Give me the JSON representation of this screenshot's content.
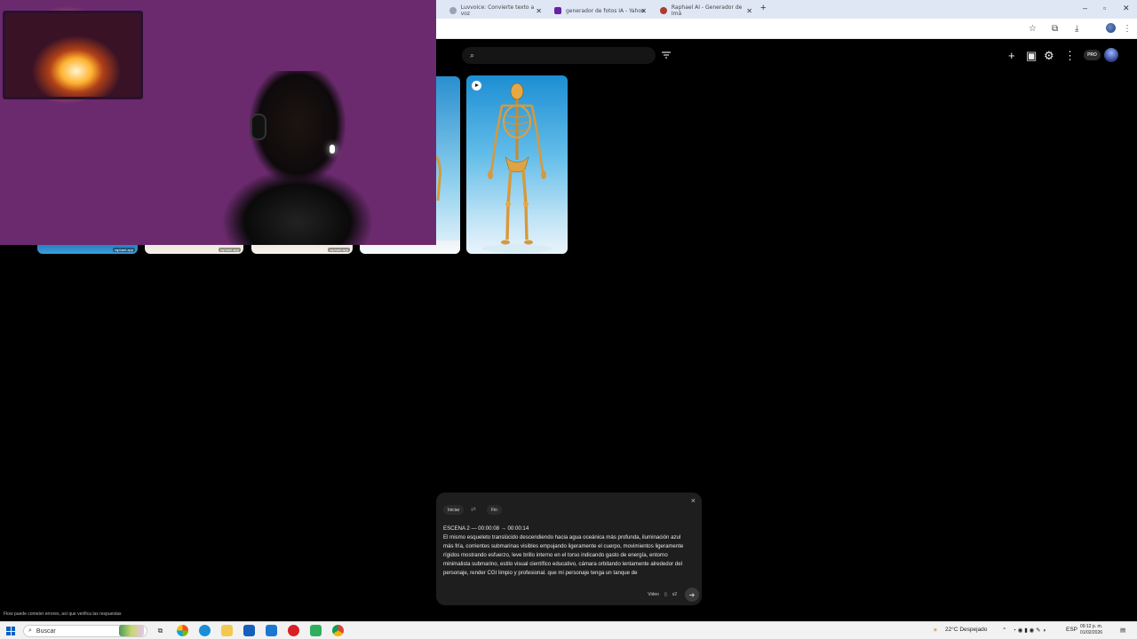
{
  "browser": {
    "tabs": [
      {
        "title": "Luvvoice: Convierte texto a voz",
        "fav_color": "#9aa3b5"
      },
      {
        "title": "generador de fotos IA - Yahoo",
        "fav_color": "#6a1fa8"
      },
      {
        "title": "Raphael AI - Generador de Imá",
        "fav_color": "#b03a2e"
      }
    ],
    "new_tab": "+",
    "window_controls": {
      "minimize": "–",
      "maximize": "▫",
      "close": "✕"
    }
  },
  "app": {
    "search": {
      "placeholder": "",
      "icon": "search-icon"
    },
    "header_icons": [
      "plus-icon",
      "film-icon",
      "gear-icon",
      "more-icon"
    ],
    "pro_badge": "PRO"
  },
  "gallery": {
    "watermark": "raphael.app"
  },
  "prompt_panel": {
    "start_chip": "Iniciar",
    "end_chip": "Fin",
    "close": "×",
    "scene_heading": "ESCENA 2 — 00:00:08 → 00:00:14",
    "prompt_text": "El mismo esqueleto translúcido descendiendo hacia agua oceánica más profunda, iluminación azul más fría, corrientes submarinas visibles empujando ligeramente el cuerpo, movimientos ligeramente rígidos mostrando esfuerzo, leve brillo interno en el torso indicando gasto de energía, entorno minimalista submarino, estilo visual científico educativo, cámara orbitando lentamente alrededor del personaje, render CGI limpio y profesional. que mi personaje tenga un tanque de",
    "mode_label": "Video",
    "count_label": "x2",
    "send_icon": "arrow-right-icon"
  },
  "disclaimer": "Flow puede cometer errores, así que verifica las respuestas",
  "taskbar": {
    "search_label": "Buscar",
    "weather": "22°C  Despejado",
    "language": "ESP",
    "time": "09:12 p. m.",
    "date": "01/02/2026"
  },
  "colors": {
    "accent_blue": "#1d8ed3",
    "panel_bg": "#1e1e1e",
    "taskbar_bg": "#f2f2f2"
  }
}
